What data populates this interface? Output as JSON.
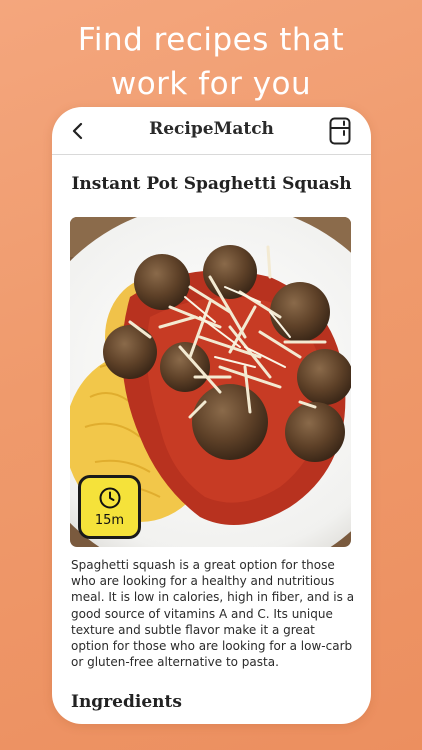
{
  "marketing": {
    "headline_line1": "Find recipes that",
    "headline_line2": "work for you"
  },
  "app": {
    "title": "RecipeMatch"
  },
  "icons": {
    "back": "chevron-left-icon",
    "fridge": "fridge-icon",
    "timer": "clock-icon"
  },
  "recipe": {
    "title": "Instant Pot Spaghetti Squash",
    "cook_time": "15m",
    "description": "Spaghetti squash is a great option for those who are looking for a healthy and nutritious meal. It is low in calories, high in fiber, and is a good source of vitamins A and C. Its unique texture and subtle flavor make it a great option for those who are looking for a low-carb or gluten-free alternative to pasta.",
    "ingredients_heading": "Ingredients"
  },
  "colors": {
    "background": "#ef9a6c",
    "timer_badge": "#f5e23a"
  }
}
